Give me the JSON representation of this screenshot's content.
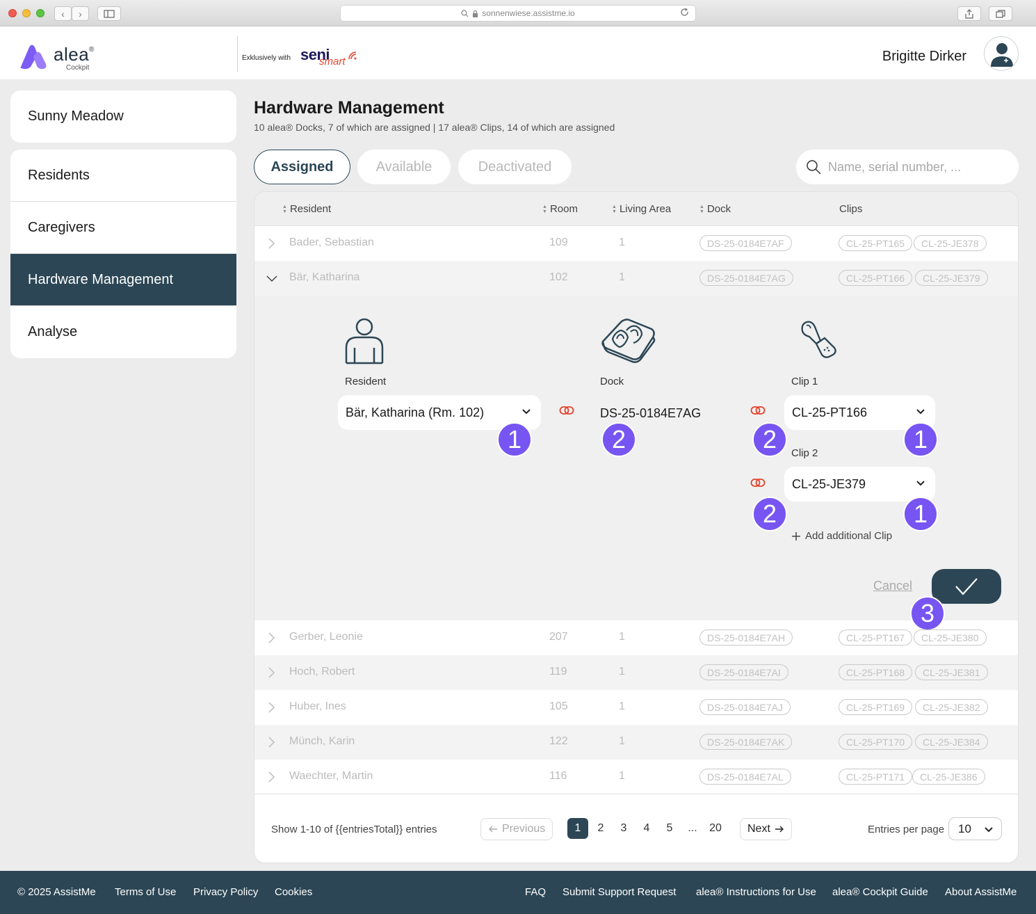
{
  "browser": {
    "url": "sonnenwiese.assistme.io"
  },
  "header": {
    "brand": "alea",
    "brand_mark": "®",
    "brand_sub": "Cockpit",
    "partner_prefix": "Exklusively with",
    "partner_brand_a": "seni",
    "partner_brand_b": "smart",
    "user_name": "Brigitte Dirker"
  },
  "sidebar": {
    "facility": "Sunny Meadow",
    "items": [
      {
        "label": "Residents"
      },
      {
        "label": "Caregivers"
      },
      {
        "label": "Hardware Management"
      },
      {
        "label": "Analyse"
      }
    ]
  },
  "page": {
    "title": "Hardware Management",
    "subtitle": "10 alea® Docks, 7 of which are assigned | 17 alea® Clips, 14 of which are assigned"
  },
  "tabs": [
    {
      "label": "Assigned"
    },
    {
      "label": "Available"
    },
    {
      "label": "Deactivated"
    }
  ],
  "search": {
    "placeholder": "Name, serial number, ..."
  },
  "table": {
    "columns": {
      "resident": "Resident",
      "room": "Room",
      "area": "Living Area",
      "dock": "Dock",
      "clips": "Clips"
    },
    "rows": [
      {
        "name": "Bader, Sebastian",
        "room": "109",
        "area": "1",
        "dock": "DS-25-0184E7AF",
        "clip1": "CL-25-PT165",
        "clip2": "CL-25-JE378"
      },
      {
        "name": "Bär, Katharina",
        "room": "102",
        "area": "1",
        "dock": "DS-25-0184E7AG",
        "clip1": "CL-25-PT166",
        "clip2": "CL-25-JE379"
      },
      {
        "name": "Gerber, Leonie",
        "room": "207",
        "area": "1",
        "dock": "DS-25-0184E7AH",
        "clip1": "CL-25-PT167",
        "clip2": "CL-25-JE380"
      },
      {
        "name": "Hoch, Robert",
        "room": "119",
        "area": "1",
        "dock": "DS-25-0184E7AI",
        "clip1": "CL-25-PT168",
        "clip2": "CL-25-JE381"
      },
      {
        "name": "Huber, Ines",
        "room": "105",
        "area": "1",
        "dock": "DS-25-0184E7AJ",
        "clip1": "CL-25-PT169",
        "clip2": "CL-25-JE382"
      },
      {
        "name": "Münch, Karin",
        "room": "122",
        "area": "1",
        "dock": "DS-25-0184E7AK",
        "clip1": "CL-25-PT170",
        "clip2": "CL-25-JE384"
      },
      {
        "name": "Waechter, Martin",
        "room": "116",
        "area": "1",
        "dock": "DS-25-0184E7AL",
        "clip1": "CL-25-PT171",
        "clip2": "CL-25-JE386"
      }
    ]
  },
  "edit": {
    "resident_label": "Resident",
    "resident_value": "Bär, Katharina (Rm. 102)",
    "dock_label": "Dock",
    "dock_value": "DS-25-0184E7AG",
    "clip1_label": "Clip 1",
    "clip1_value": "CL-25-PT166",
    "clip2_label": "Clip 2",
    "clip2_value": "CL-25-JE379",
    "add_clip": "Add additional Clip",
    "cancel": "Cancel",
    "badges": {
      "one": "1",
      "two": "2",
      "three": "3"
    }
  },
  "pagination": {
    "summary": "Show 1-10 of {{entriesTotal}} entries",
    "previous": "Previous",
    "next": "Next",
    "pages": [
      "1",
      "2",
      "3",
      "4",
      "5",
      "...",
      "20"
    ],
    "entries_label": "Entries per page",
    "entries_value": "10"
  },
  "footer": {
    "copyright": "© 2025 AssistMe",
    "links": [
      "Terms of Use",
      "Privacy Policy",
      "Cookies"
    ],
    "right_links": [
      "FAQ",
      "Submit Support Request",
      "alea® Instructions for Use",
      "alea® Cockpit Guide",
      "About AssistMe"
    ]
  },
  "colors": {
    "primary": "#2c4655",
    "accent": "#7755f2",
    "link": "#e4412c",
    "brand_logo": "#7c5cf4"
  },
  "icons": [
    "search-icon",
    "lock-icon",
    "reload-icon",
    "share-icon",
    "tabs-icon",
    "sidebar-toggle-icon",
    "chevron-right-icon",
    "chevron-down-icon",
    "link-icon",
    "plus-icon",
    "check-icon",
    "arrow-left-icon",
    "arrow-right-icon",
    "person-icon",
    "dock-icon",
    "clip-icon",
    "avatar-icon",
    "sort-icon"
  ]
}
